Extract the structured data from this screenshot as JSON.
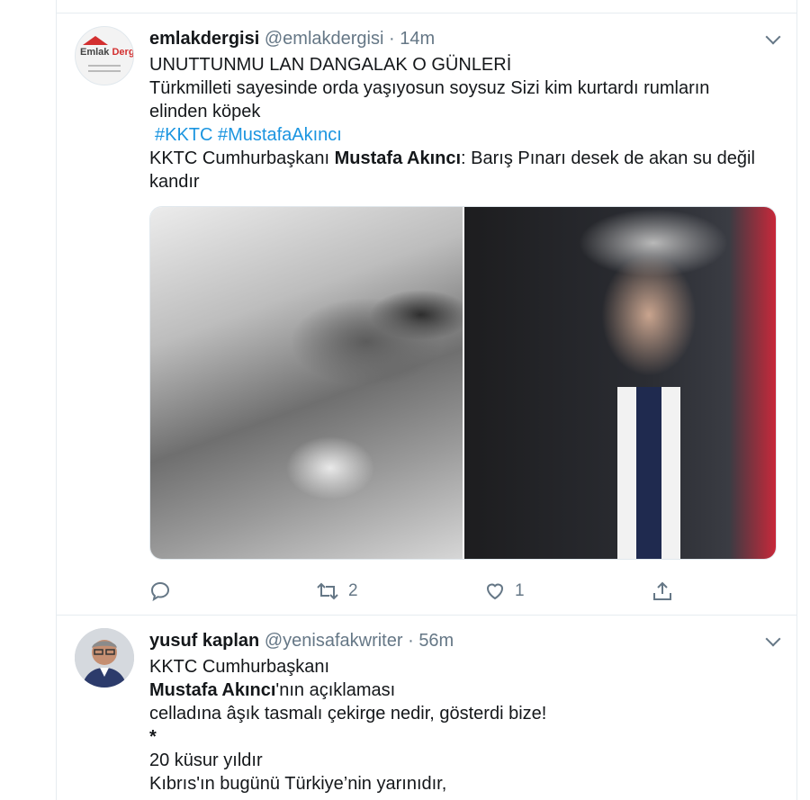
{
  "tweets": [
    {
      "name": "emlakdergisi",
      "handle": "@emlakdergisi",
      "separator": "·",
      "time": "14m",
      "avatar_logo": {
        "part1": "Emlak",
        "part2": "Dergisi"
      },
      "lines": [
        "UNUTTUNMU LAN DANGALAK O GÜNLERİ",
        "Türkmilleti sayesinde orda yaşıyosun soysuz Sizi kim kurtardı rumların",
        "elinden köpek"
      ],
      "hashtags": "#KKTC #MustafaAkıncı",
      "quote": {
        "pre": "KKTC Cumhurbaşkanı ",
        "bold": "Mustafa Akıncı",
        "post": ": Barış Pınarı desek de akan su değil",
        "line2": "kandır"
      },
      "actions": {
        "retweets": "2",
        "likes": "1"
      }
    },
    {
      "name": "yusuf kaplan",
      "handle": "@yenisafakwriter",
      "separator": "·",
      "time": "56m",
      "lines": [
        "KKTC Cumhurbaşkanı"
      ],
      "bold_line": {
        "bold": "Mustafa Akıncı",
        "post": "'nın açıklaması"
      },
      "lines2": [
        "celladına âşık tasmalı çekirge nedir, gösterdi bize!",
        "*",
        "20 küsur yıldır",
        "Kıbrıs'ın bugünü Türkiye’nin yarınıdır,"
      ]
    }
  ],
  "icons": {
    "reply": "reply-icon",
    "retweet": "retweet-icon",
    "like": "heart-icon",
    "share": "share-icon",
    "more": "chevron-down-icon"
  },
  "colors": {
    "link": "#1b95e0",
    "muted": "#657786",
    "border": "#e6ecf0"
  }
}
